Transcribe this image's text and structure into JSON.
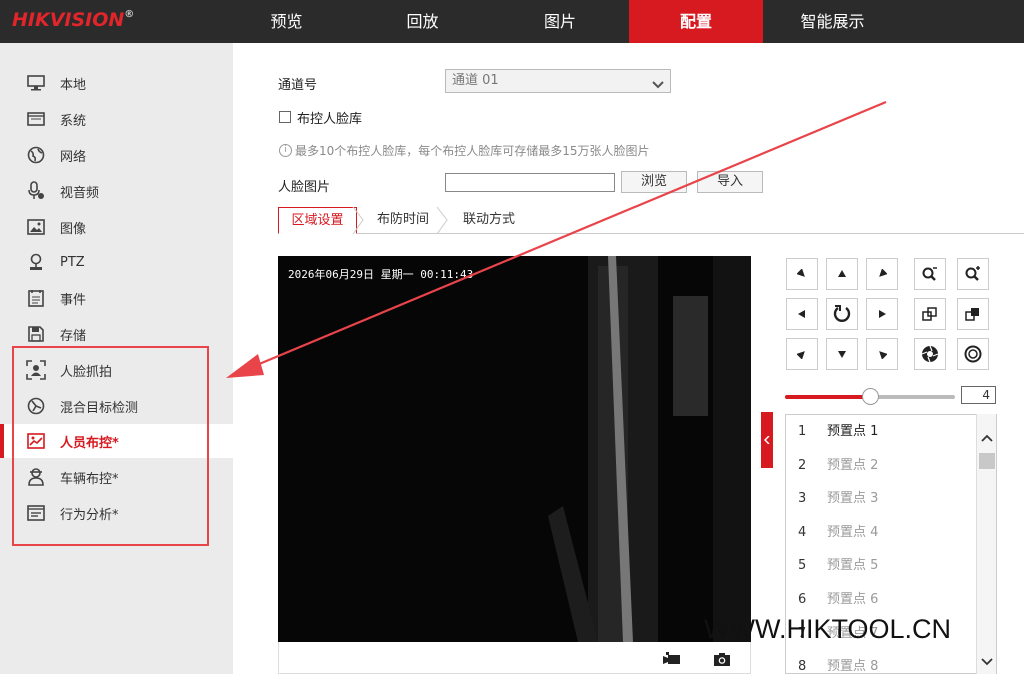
{
  "brand": {
    "logo_text": "HIKVISION",
    "logo_mark": "®",
    "accent": "#d71920"
  },
  "nav": {
    "tabs": [
      {
        "label": "预览"
      },
      {
        "label": "回放"
      },
      {
        "label": "图片"
      },
      {
        "label": "配置",
        "active": true
      },
      {
        "label": "智能展示"
      }
    ]
  },
  "sidebar": {
    "items": [
      {
        "label": "本地",
        "icon": "monitor-icon"
      },
      {
        "label": "系统",
        "icon": "system-icon"
      },
      {
        "label": "网络",
        "icon": "globe-icon"
      },
      {
        "label": "视音频",
        "icon": "mic-icon"
      },
      {
        "label": "图像",
        "icon": "image-icon"
      },
      {
        "label": "PTZ",
        "icon": "ptz-icon"
      },
      {
        "label": "事件",
        "icon": "event-icon"
      },
      {
        "label": "存储",
        "icon": "storage-icon"
      },
      {
        "label": "人脸抓拍",
        "icon": "face-capture-icon"
      },
      {
        "label": "混合目标检测",
        "icon": "mixed-target-icon"
      },
      {
        "label": "人员布控*",
        "icon": "person-deploy-icon",
        "active": true
      },
      {
        "label": "车辆布控*",
        "icon": "vehicle-deploy-icon"
      },
      {
        "label": "行为分析*",
        "icon": "behavior-icon"
      }
    ],
    "highlight_color": "#e8444a"
  },
  "form": {
    "channel_label": "通道号",
    "channel_value": "通道 01",
    "face_lib_checkbox_label": "布控人脸库",
    "face_lib_checked": false,
    "hint": "最多10个布控人脸库，每个布控人脸库可存储最多15万张人脸图片",
    "face_image_label": "人脸图片",
    "face_image_value": "",
    "browse_label": "浏览",
    "import_label": "导入"
  },
  "subtabs": [
    {
      "label": "区域设置",
      "active": true
    },
    {
      "label": "布防时间"
    },
    {
      "label": "联动方式"
    }
  ],
  "video": {
    "osd_text": "2026年06月29日 星期一 00:11:43"
  },
  "ptz": {
    "speed_value": "4",
    "speed_level_fraction": 0.5
  },
  "presets": [
    {
      "num": "1",
      "name": "预置点 1"
    },
    {
      "num": "2",
      "name": "预置点 2"
    },
    {
      "num": "3",
      "name": "预置点 3"
    },
    {
      "num": "4",
      "name": "预置点 4"
    },
    {
      "num": "5",
      "name": "预置点 5"
    },
    {
      "num": "6",
      "name": "预置点 6"
    },
    {
      "num": "7",
      "name": "预置点 7"
    },
    {
      "num": "8",
      "name": "预置点 8"
    }
  ],
  "watermark": "WWW.HIKTOOL.CN"
}
